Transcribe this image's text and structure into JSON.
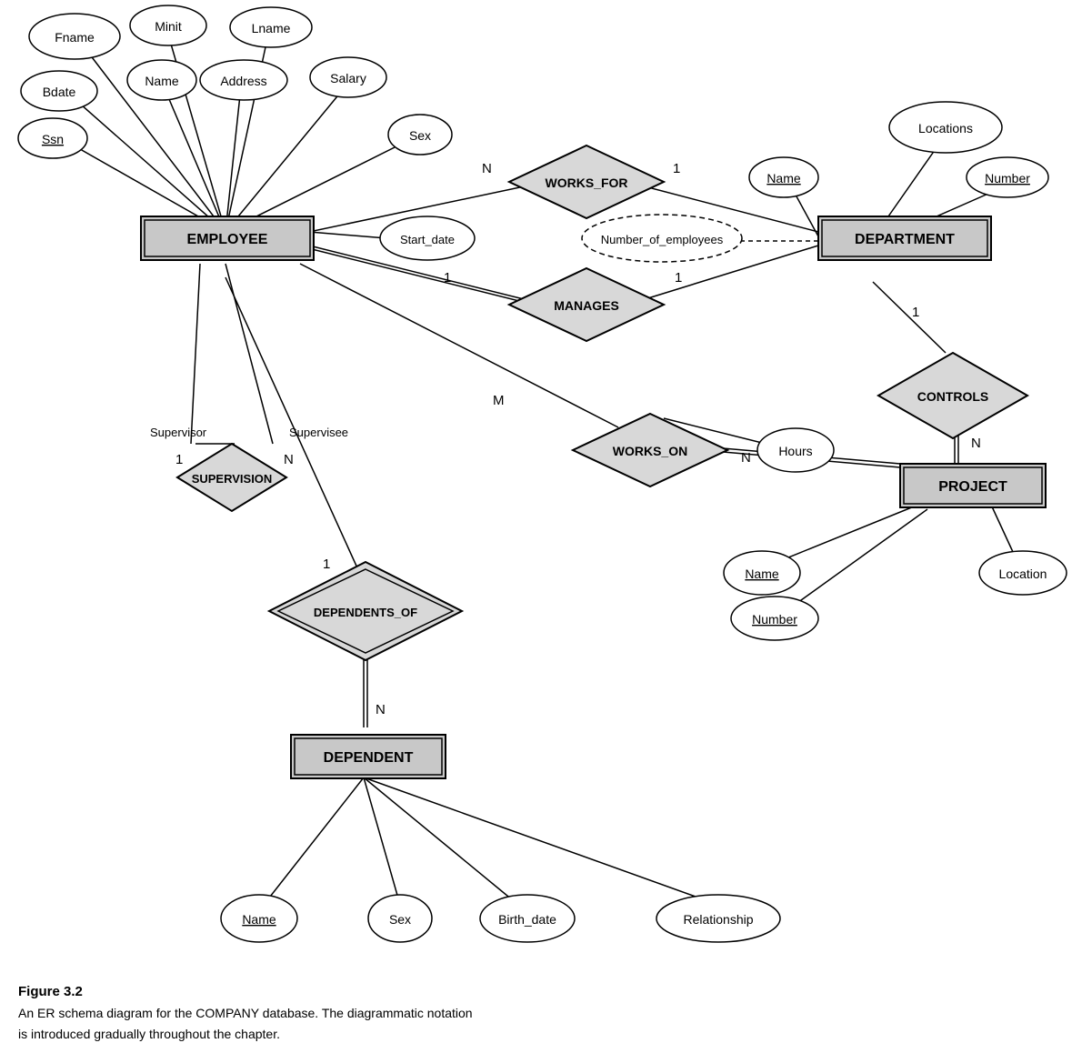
{
  "caption": {
    "title": "Figure 3.2",
    "line1": "An ER schema diagram for the COMPANY database. The diagrammatic notation",
    "line2": "is introduced gradually throughout the chapter."
  },
  "entities": {
    "employee": "EMPLOYEE",
    "department": "DEPARTMENT",
    "project": "PROJECT",
    "dependent": "DEPENDENT"
  },
  "relationships": {
    "works_for": "WORKS_FOR",
    "manages": "MANAGES",
    "controls": "CONTROLS",
    "works_on": "WORKS_ON",
    "supervision": "SUPERVISION",
    "dependents_of": "DEPENDENTS_OF"
  },
  "attributes": {
    "fname": "Fname",
    "minit": "Minit",
    "lname": "Lname",
    "bdate": "Bdate",
    "name_emp": "Name",
    "address": "Address",
    "salary": "Salary",
    "ssn": "Ssn",
    "sex_emp": "Sex",
    "start_date": "Start_date",
    "number_of_employees": "Number_of_employees",
    "locations": "Locations",
    "dept_name": "Name",
    "dept_number": "Number",
    "hours": "Hours",
    "proj_name": "Name",
    "proj_number": "Number",
    "location": "Location",
    "dep_name": "Name",
    "dep_sex": "Sex",
    "birth_date": "Birth_date",
    "relationship": "Relationship"
  },
  "cardinalities": {
    "n1": "N",
    "one1": "1",
    "one2": "1",
    "one3": "1",
    "m1": "M",
    "n2": "N",
    "n3": "N",
    "one4": "1",
    "supervisor": "Supervisor",
    "supervisee": "Supervisee",
    "one5": "1",
    "n4": "N",
    "n5": "N"
  }
}
